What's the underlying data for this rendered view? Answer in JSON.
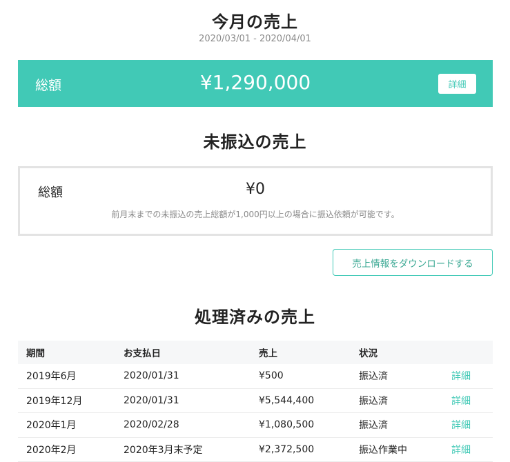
{
  "month_sales": {
    "title": "今月の売上",
    "date_range": "2020/03/01 - 2020/04/01",
    "total_label": "総額",
    "total_amount": "¥1,290,000",
    "detail_label": "詳細"
  },
  "unpaid_sales": {
    "title": "未振込の売上",
    "total_label": "総額",
    "total_amount": "¥0",
    "note": "前月末までの未振込の売上総額が1,000円以上の場合に振込依頼が可能です。"
  },
  "download_label": "売上情報をダウンロードする",
  "processed_sales": {
    "title": "処理済みの売上",
    "headers": [
      "期間",
      "お支払日",
      "売上",
      "状況",
      ""
    ],
    "rows": [
      {
        "period": "2019年6月",
        "pay_date": "2020/01/31",
        "amount": "¥500",
        "status": "振込済",
        "link": "詳細"
      },
      {
        "period": "2019年12月",
        "pay_date": "2020/01/31",
        "amount": "¥5,544,400",
        "status": "振込済",
        "link": "詳細"
      },
      {
        "period": "2020年1月",
        "pay_date": "2020/02/28",
        "amount": "¥1,080,500",
        "status": "振込済",
        "link": "詳細"
      },
      {
        "period": "2020年2月",
        "pay_date": "2020年3月末予定",
        "amount": "¥2,372,500",
        "status": "振込作業中",
        "link": "詳細"
      }
    ]
  },
  "colors": {
    "accent": "#41c9b6",
    "border": "#e3e3e3",
    "muted": "#8a8a8a"
  }
}
